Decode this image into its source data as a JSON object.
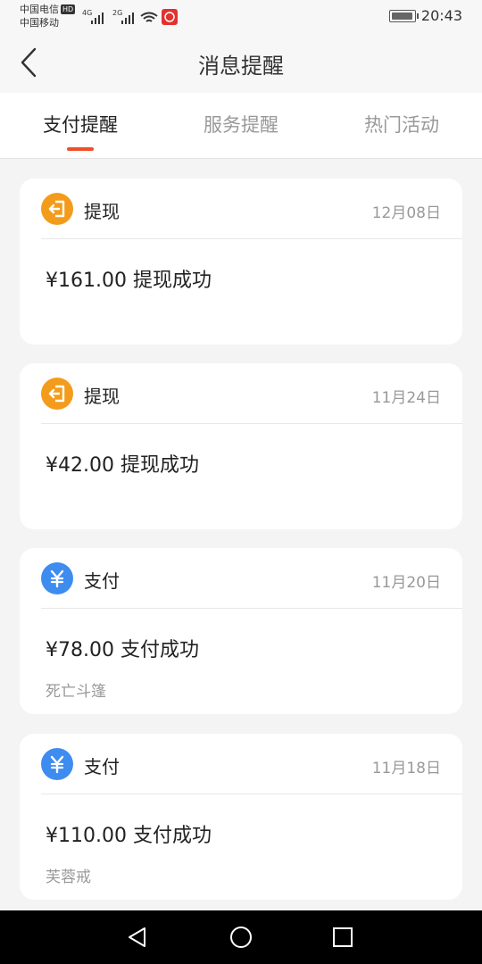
{
  "status_bar": {
    "carrier_1": "中国电信",
    "hd_badge": "HD",
    "carrier_2": "中国移动",
    "net_1": "4G",
    "net_2": "2G",
    "time": "20:43",
    "battery_level": 0.95
  },
  "header": {
    "title": "消息提醒"
  },
  "tabs": [
    {
      "label": "支付提醒",
      "active": true
    },
    {
      "label": "服务提醒",
      "active": false
    },
    {
      "label": "热门活动",
      "active": false
    }
  ],
  "colors": {
    "accent": "#f04e2a",
    "withdraw_icon": "#f39c1b",
    "pay_icon": "#3e8cf0"
  },
  "messages": [
    {
      "icon": "withdraw-icon",
      "type": "提现",
      "date": "12月08日",
      "amount_text": "¥161.00 提现成功",
      "subtitle": ""
    },
    {
      "icon": "withdraw-icon",
      "type": "提现",
      "date": "11月24日",
      "amount_text": "¥42.00 提现成功",
      "subtitle": ""
    },
    {
      "icon": "yuan-icon",
      "type": "支付",
      "date": "11月20日",
      "amount_text": "¥78.00 支付成功",
      "subtitle": "死亡斗篷"
    },
    {
      "icon": "yuan-icon",
      "type": "支付",
      "date": "11月18日",
      "amount_text": "¥110.00 支付成功",
      "subtitle": "芙蓉戒"
    }
  ]
}
